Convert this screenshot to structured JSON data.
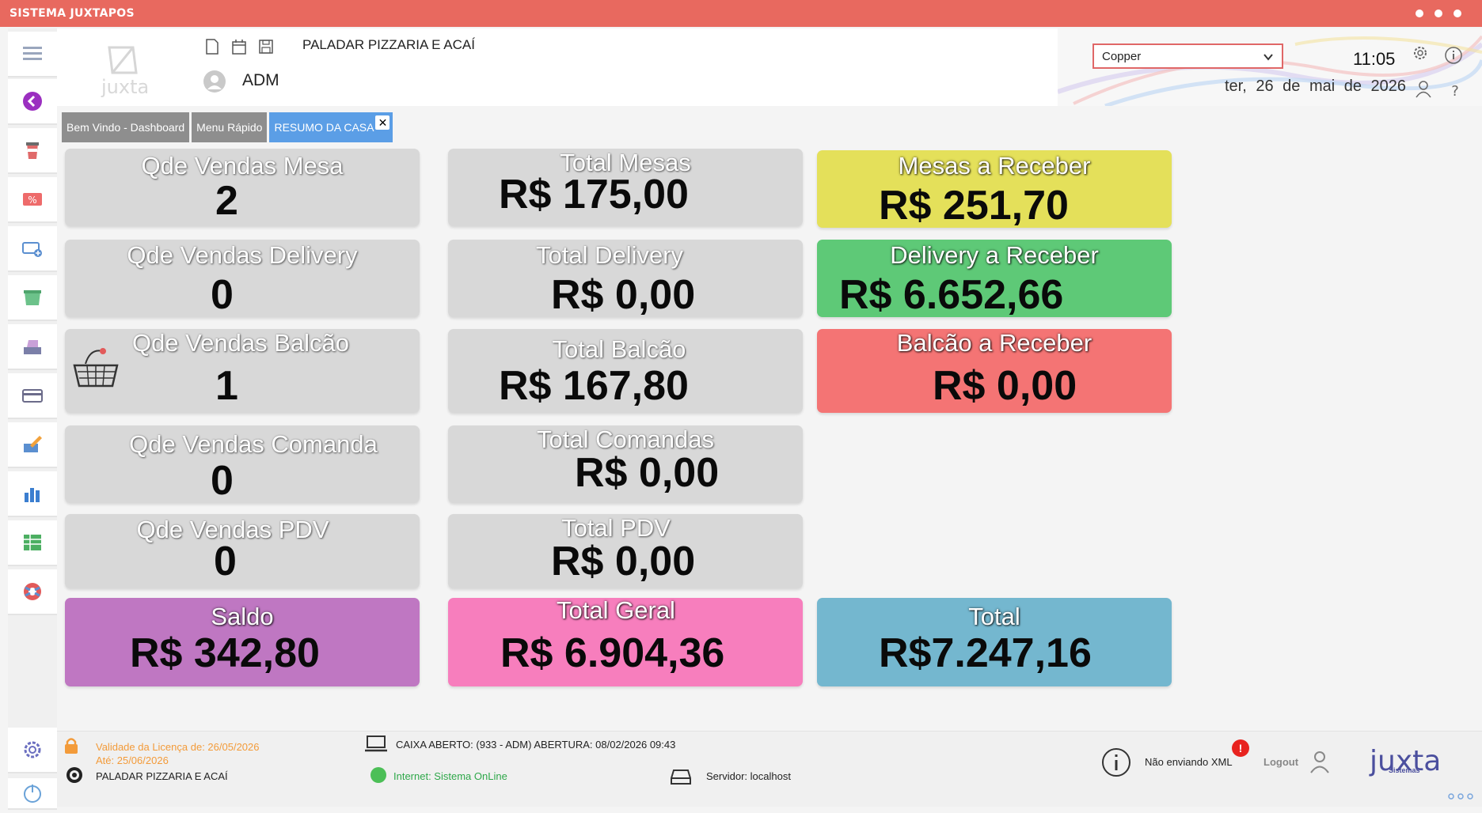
{
  "window": {
    "title": "SISTEMA JUXTAPOS"
  },
  "header": {
    "company": "PALADAR PIZZARIA E ACAÍ",
    "user": "ADM",
    "logo_text": "juxta"
  },
  "topbar": {
    "theme_selected": "Copper",
    "time": "11:05",
    "date": "ter, 26 de mai de 2026"
  },
  "tabs": [
    {
      "label": "Bem Vindo - Dashboard"
    },
    {
      "label": "Menu Rápido"
    },
    {
      "label": "RESUMO DA CASA"
    }
  ],
  "dashboard": {
    "qtd_mesa": {
      "label": "Qde Vendas Mesa",
      "value": "2"
    },
    "qtd_delivery": {
      "label": "Qde Vendas Delivery",
      "value": "0"
    },
    "qtd_balcao": {
      "label": "Qde Vendas Balcão",
      "value": "1"
    },
    "qtd_comanda": {
      "label": "Qde Vendas Comanda",
      "value": "0"
    },
    "qtd_pdv": {
      "label": "Qde Vendas PDV",
      "value": "0"
    },
    "total_mesas": {
      "label": "Total Mesas",
      "value": "R$ 175,00"
    },
    "total_delivery": {
      "label": "Total Delivery",
      "value": "R$ 0,00"
    },
    "total_balcao": {
      "label": "Total Balcão",
      "value": "R$ 167,80"
    },
    "total_comandas": {
      "label": "Total Comandas",
      "value": "R$ 0,00"
    },
    "total_pdv": {
      "label": "Total PDV",
      "value": "R$ 0,00"
    },
    "mesas_receber": {
      "label": "Mesas a Receber",
      "value": "R$ 251,70"
    },
    "delivery_receber": {
      "label": "Delivery a Receber",
      "value": "R$ 6.652,66"
    },
    "balcao_receber": {
      "label": "Balcão a Receber",
      "value": "R$ 0,00"
    },
    "saldo": {
      "label": "Saldo",
      "value": "R$ 342,80"
    },
    "total_geral": {
      "label": "Total Geral",
      "value": "R$ 6.904,36"
    },
    "total": {
      "label": "Total",
      "value": "R$7.247,16"
    }
  },
  "colors": {
    "titlebar": "#e8695f",
    "card_gray": "#d8d8d8",
    "yellow": "#e4e05a",
    "green": "#5ec977",
    "red": "#f47474",
    "purple": "#bf77c2",
    "pink": "#f77ebd",
    "blue": "#74b7cf",
    "active_tab": "#5b9ee6"
  },
  "footer": {
    "license_valid": "Validade da Licença de: 26/05/2026",
    "license_until": "Até: 25/06/2026",
    "company": "PALADAR PIZZARIA E ACAÍ",
    "caixa": "CAIXA ABERTO: (933 - ADM) ABERTURA: 08/02/2026 09:43",
    "internet": "Internet: Sistema OnLine",
    "server": "Servidor: localhost",
    "xml_status": "Não enviando XML",
    "xml_badge": "!",
    "logout": "Logout",
    "brand": "juxta",
    "brand_sub": "Sistemas"
  }
}
